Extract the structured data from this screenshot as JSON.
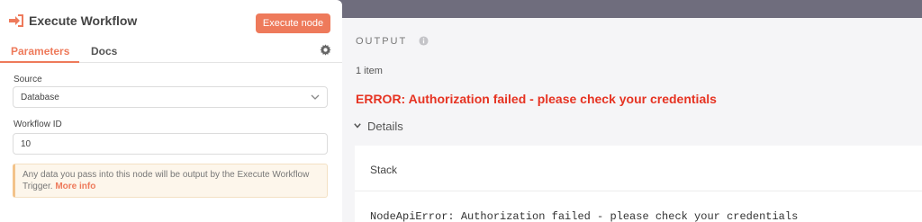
{
  "node": {
    "title": "Execute Workflow",
    "execute_label": "Execute node",
    "accent_color": "#ee7a5b"
  },
  "tabs": [
    {
      "label": "Parameters",
      "active": true
    },
    {
      "label": "Docs",
      "active": false
    }
  ],
  "params": {
    "source_label": "Source",
    "source_value": "Database",
    "workflow_id_label": "Workflow ID",
    "workflow_id_value": "10",
    "info_text": "Any data you pass into this node will be output by the Execute Workflow Trigger.",
    "info_link": "More info"
  },
  "output": {
    "title": "OUTPUT",
    "item_count": "1 item",
    "error_message": "ERROR: Authorization failed - please check your credentials",
    "error_color": "#e63322",
    "details_label": "Details",
    "stack_title": "Stack",
    "stack_text": "NodeApiError: Authorization failed - please check your credentials"
  },
  "icons": {
    "node": "sign-in-arrow-icon",
    "settings": "gear-icon",
    "info": "info-circle-icon",
    "source_dropdown": "chevron-down-icon",
    "details": "caret-down-icon"
  }
}
